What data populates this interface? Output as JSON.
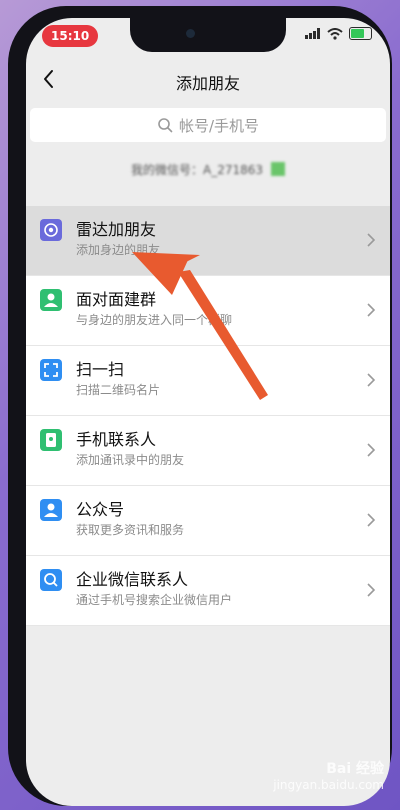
{
  "status": {
    "time": "15:10"
  },
  "nav": {
    "title": "添加朋友"
  },
  "search": {
    "placeholder": "帐号/手机号"
  },
  "my_account": {
    "text": "我的微信号：A_271863"
  },
  "items": [
    {
      "title": "雷达加朋友",
      "subtitle": "添加身边的朋友",
      "icon": "radar-icon",
      "color": "#6a6adb"
    },
    {
      "title": "面对面建群",
      "subtitle": "与身边的朋友进入同一个群聊",
      "icon": "group-icon",
      "color": "#2fbf71"
    },
    {
      "title": "扫一扫",
      "subtitle": "扫描二维码名片",
      "icon": "scan-icon",
      "color": "#2f8ef2"
    },
    {
      "title": "手机联系人",
      "subtitle": "添加通讯录中的朋友",
      "icon": "phone-contacts-icon",
      "color": "#2fbf71"
    },
    {
      "title": "公众号",
      "subtitle": "获取更多资讯和服务",
      "icon": "official-account-icon",
      "color": "#2f8ef2"
    },
    {
      "title": "企业微信联系人",
      "subtitle": "通过手机号搜索企业微信用户",
      "icon": "work-contacts-icon",
      "color": "#2f8ef2"
    }
  ],
  "watermark": {
    "brand": "Bai 经验",
    "url": "jingyan.baidu.com"
  }
}
